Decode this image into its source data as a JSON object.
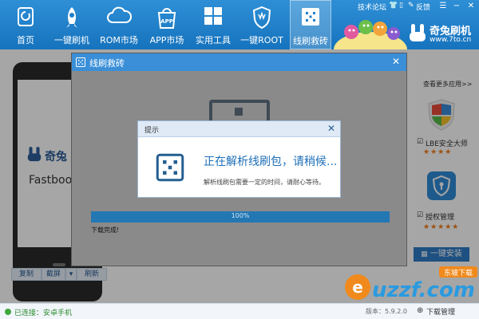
{
  "nav": {
    "items": [
      {
        "label": "首页",
        "icon": "home-icon"
      },
      {
        "label": "一键刷机",
        "icon": "rocket-icon"
      },
      {
        "label": "ROM市场",
        "icon": "cloud-icon"
      },
      {
        "label": "APP市场",
        "icon": "app-bag-icon"
      },
      {
        "label": "实用工具",
        "icon": "grid-icon"
      },
      {
        "label": "一键ROOT",
        "icon": "shield-root-icon"
      },
      {
        "label": "线刷救砖",
        "icon": "dice-icon"
      }
    ],
    "active_index": 6
  },
  "top_links": {
    "forum": "技术论坛",
    "feedback": "反馈"
  },
  "brand": {
    "name": "奇兔刷机",
    "url": "www.7to.cn"
  },
  "device": {
    "logo_text": "奇兔",
    "mode_text": "Fastboot"
  },
  "device_actions": {
    "copy": "复制",
    "screenshot": "截屏",
    "refresh": "刷新"
  },
  "recommend": {
    "more_link": "查看更多应用>>",
    "apps": [
      {
        "name": "LBE安全大师",
        "stars": "★★★★"
      },
      {
        "name": "授权管理",
        "stars": "★★★★★"
      }
    ],
    "install_label": "一键安装"
  },
  "flash_dialog": {
    "title": "线刷救砖",
    "progress": 100,
    "progress_text": "100%",
    "status_text": "下载完成!"
  },
  "tip_dialog": {
    "title": "提示",
    "main": "正在解析线刷包，请稍候...",
    "sub": "解析线刷包需要一定的时间，请耐心等待。"
  },
  "status": {
    "connection": "已连接：安卓手机",
    "version": "版本：5.9.2.0",
    "download_manager": "下载管理"
  },
  "watermark": {
    "text": "uzzf.com",
    "badge": "东坡下载"
  },
  "colors": {
    "primary": "#1f7fcc",
    "accent": "#2f7cc7",
    "star": "#f07d18"
  }
}
